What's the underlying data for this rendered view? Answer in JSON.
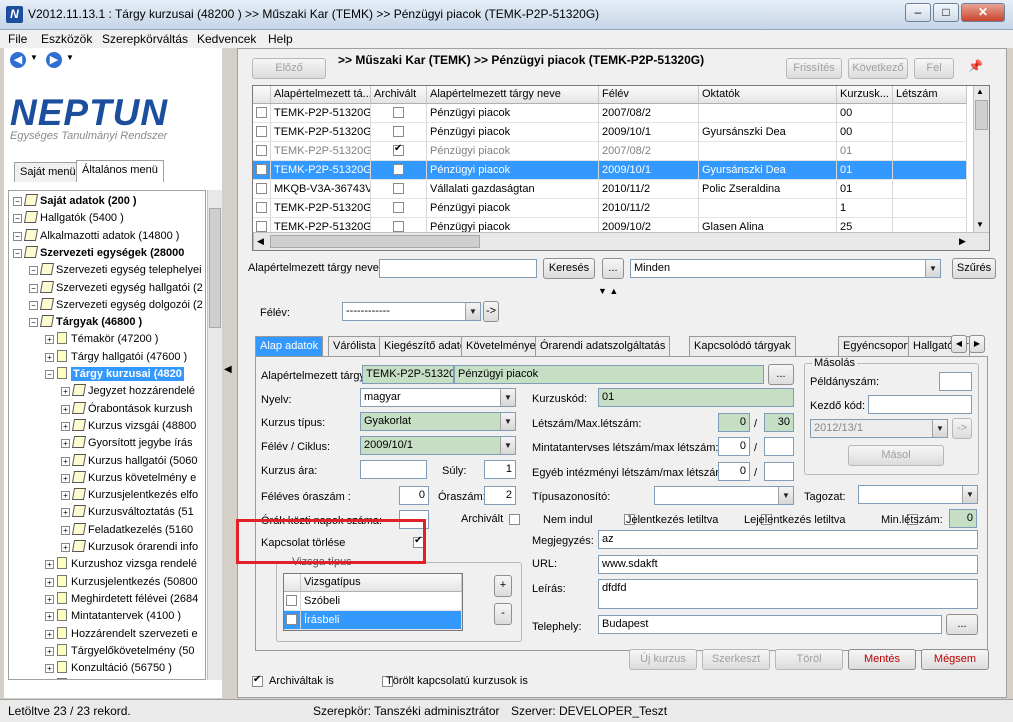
{
  "window": {
    "title": "V2012.11.13.1 : Tárgy kurzusai (48200  )  >> Műszaki Kar (TEMK) >> Pénzügyi piacok (TEMK-P2P-51320G)",
    "app_icon": "N",
    "minimize": "–",
    "maximize": "□",
    "close": "✕"
  },
  "menu": [
    "File",
    "Eszközök",
    "Szerepkörváltás",
    "Kedvencek",
    "Help"
  ],
  "logo": {
    "text": "NEPTUN",
    "subtitle": "Egységes Tanulmányi Rendszer"
  },
  "left_tabs": [
    "Saját menü",
    "Általános menü"
  ],
  "tree": [
    {
      "label": "Saját adatok (200 )",
      "bold": true,
      "level": 0,
      "icon": "diamond"
    },
    {
      "label": "Hallgatók (5400 )",
      "bold": false,
      "level": 0,
      "icon": "diamond"
    },
    {
      "label": "Alkalmazotti adatok (14800 )",
      "bold": false,
      "level": 0,
      "icon": "diamond"
    },
    {
      "label": "Szervezeti egységek (28000",
      "bold": true,
      "level": 0,
      "icon": "diamond"
    },
    {
      "label": "Szervezeti egység telephelyei",
      "bold": false,
      "level": 1,
      "icon": "diamond"
    },
    {
      "label": "Szervezeti egység hallgatói (2",
      "bold": false,
      "level": 1,
      "icon": "diamond"
    },
    {
      "label": "Szervezeti egység dolgozói (2",
      "bold": false,
      "level": 1,
      "icon": "diamond"
    },
    {
      "label": "Tárgyak (46800 )",
      "bold": true,
      "level": 1,
      "icon": "diamond"
    },
    {
      "label": "Témakör (47200 )",
      "bold": false,
      "level": 2,
      "icon": "doc"
    },
    {
      "label": "Tárgy hallgatói (47600 )",
      "bold": false,
      "level": 2,
      "icon": "doc"
    },
    {
      "label": "Tárgy kurzusai (4820",
      "bold": true,
      "level": 2,
      "icon": "doc",
      "selected": true
    },
    {
      "label": "Jegyzet hozzárendelé",
      "bold": false,
      "level": 3,
      "icon": "diamond"
    },
    {
      "label": "Órabontások kurzush",
      "bold": false,
      "level": 3,
      "icon": "diamond"
    },
    {
      "label": "Kurzus vizsgái (48800",
      "bold": false,
      "level": 3,
      "icon": "diamond"
    },
    {
      "label": "Gyorsított jegybe írás",
      "bold": false,
      "level": 3,
      "icon": "diamond"
    },
    {
      "label": "Kurzus hallgatói (5060",
      "bold": false,
      "level": 3,
      "icon": "diamond"
    },
    {
      "label": "Kurzus követelmény e",
      "bold": false,
      "level": 3,
      "icon": "diamond"
    },
    {
      "label": "Kurzusjelentkezés elfo",
      "bold": false,
      "level": 3,
      "icon": "diamond"
    },
    {
      "label": "Kurzusváltoztatás (51",
      "bold": false,
      "level": 3,
      "icon": "diamond"
    },
    {
      "label": "Feladatkezelés (5160",
      "bold": false,
      "level": 3,
      "icon": "diamond"
    },
    {
      "label": "Kurzusok órarendi info",
      "bold": false,
      "level": 3,
      "icon": "diamond"
    },
    {
      "label": "Kurzushoz vizsga rendelé",
      "bold": false,
      "level": 2,
      "icon": "doc"
    },
    {
      "label": "Kurzusjelentkezés (50800",
      "bold": false,
      "level": 2,
      "icon": "doc"
    },
    {
      "label": "Meghirdetett félévei (2684",
      "bold": false,
      "level": 2,
      "icon": "doc"
    },
    {
      "label": "Mintatantervek (4100 )",
      "bold": false,
      "level": 2,
      "icon": "doc"
    },
    {
      "label": "Hozzárendelt szervezeti e",
      "bold": false,
      "level": 2,
      "icon": "doc"
    },
    {
      "label": "Tárgyelőkövetelmény (50",
      "bold": false,
      "level": 2,
      "icon": "doc"
    },
    {
      "label": "Konzultáció (56750 )",
      "bold": false,
      "level": 2,
      "icon": "doc"
    },
    {
      "label": "Tárgy költsége (65350 )",
      "bold": false,
      "level": 2,
      "icon": "doc"
    },
    {
      "label": "Hozzárendelt tárgyak (2650 )",
      "bold": false,
      "level": 1,
      "icon": "diamond"
    },
    {
      "label": "Tárgycsoportok (54000 )",
      "bold": false,
      "level": 1,
      "icon": "diamond"
    }
  ],
  "toolbar": {
    "prev": "Előző",
    "breadcrumb": ">> Műszaki Kar (TEMK) >> Pénzügyi piacok (TEMK-P2P-51320G)",
    "refresh": "Frissítés",
    "next": "Következő",
    "up": "Fel",
    "pin": "📌"
  },
  "grid": {
    "columns": [
      "",
      "Alapértelmezett tá...",
      "Archivált",
      "Alapértelmezett tárgy neve",
      "Félév",
      "Oktatók",
      "Kurzusk...",
      "Létszám"
    ],
    "rows": [
      {
        "code": "TEMK-P2P-51320G",
        "archived": false,
        "name": "Pénzügyi piacok",
        "term": "2007/08/2",
        "teachers": "",
        "course": "00",
        "grey": false,
        "selected": false
      },
      {
        "code": "TEMK-P2P-51320G",
        "archived": false,
        "name": "Pénzügyi piacok",
        "term": "2009/10/1",
        "teachers": "Gyursánszki Dea",
        "course": "00",
        "grey": false,
        "selected": false
      },
      {
        "code": "TEMK-P2P-51320G",
        "archived": true,
        "name": "Pénzügyi piacok",
        "term": "2007/08/2",
        "teachers": "",
        "course": "01",
        "grey": true,
        "selected": false
      },
      {
        "code": "TEMK-P2P-51320G",
        "archived": false,
        "name": "Pénzügyi piacok",
        "term": "2009/10/1",
        "teachers": "Gyursánszki Dea",
        "course": "01",
        "grey": false,
        "selected": true
      },
      {
        "code": "MKQB-V3A-36743V",
        "archived": false,
        "name": "Vállalati gazdaságtan",
        "term": "2010/11/2",
        "teachers": "Polic Zseraldina",
        "course": "01",
        "grey": false,
        "selected": false
      },
      {
        "code": "TEMK-P2P-51320G",
        "archived": false,
        "name": "Pénzügyi piacok",
        "term": "2010/11/2",
        "teachers": "",
        "course": "1",
        "grey": false,
        "selected": false
      },
      {
        "code": "TEMK-P2P-51320G",
        "archived": false,
        "name": "Pénzügyi piacok",
        "term": "2009/10/2",
        "teachers": "Glasen Alina",
        "course": "25",
        "grey": false,
        "selected": false
      }
    ]
  },
  "search": {
    "label": "Alapértelmezett tárgy neve",
    "value": "",
    "button": "Keresés",
    "ellipsis": "...",
    "filter_value": "Minden",
    "filter_button": "Szűrés"
  },
  "semester": {
    "label": "Félév:",
    "value": "------------",
    "go": "->"
  },
  "detail_tabs": [
    "Alap adatok",
    "Várólista",
    "Kiegészítő adatok",
    "Követelmények",
    "Órarendi adatszolgáltatás",
    "Kapcsolódó tárgyak",
    "Egyéncsoportok",
    "Hallgatói ered"
  ],
  "form": {
    "default_subject_label": "Alapértelmezett tárgy:",
    "default_subject_code": "TEMK-P2P-51320G",
    "default_subject_name": "Pénzügyi piacok",
    "language_label": "Nyelv:",
    "language": "magyar",
    "course_type_label": "Kurzus típus:",
    "course_type": "Gyakorlat",
    "term_label": "Félév / Ciklus:",
    "term": "2009/10/1",
    "price_label": "Kurzus ára:",
    "price": "",
    "weight_label": "Súly:",
    "weight": "1",
    "hours_label": "Féléves óraszám :",
    "hours": "0",
    "weekly_hours_label": "Óraszám:",
    "weekly_hours": "2",
    "break_label": "Órák közti napok száma:",
    "break": "",
    "archived_label": "Archivált",
    "delete_rel_label": "Kapcsolat törlése",
    "course_code_label": "Kurzuskód:",
    "course_code": "01",
    "headcount_label": "Létszám/Max.létszám:",
    "headcount": "0",
    "max_headcount": "30",
    "curriculum_label": "Mintatantervses létszám/max létszám:",
    "curriculum_count": "0",
    "other_label": "Egyéb intézményi létszám/max létszám:",
    "other_count": "0",
    "type_id_label": "Típusazonosító:",
    "tagozat_label": "Tagozat:",
    "not_started_label": "Nem indul",
    "reg_block_label": "Jelentkezés letiltva",
    "dereg_block_label": "Lejelentkezés letiltva",
    "min_count_label": "Min.létszám:",
    "min_count": "0",
    "note_label": "Megjegyzés:",
    "note": "az",
    "url_label": "URL:",
    "url": "www.sdakft",
    "desc_label": "Leírás:",
    "desc": "dfdfd",
    "site_label": "Telephely:",
    "site": "Budapest",
    "exam_type_group": "Vizsga típus",
    "exam_type_header": "Vizsgatípus",
    "exam_types": [
      "Szóbeli",
      "Írásbeli"
    ],
    "plus": "+",
    "minus": "-"
  },
  "copy": {
    "title": "Másolás",
    "count_label": "Példányszám:",
    "start_label": "Kezdő kód:",
    "term": "2012/13/1",
    "arrow": "->",
    "button": "Másol"
  },
  "actions": {
    "new": "Új kurzus",
    "edit": "Szerkeszt",
    "delete": "Töröl",
    "save": "Mentés",
    "cancel": "Mégsem"
  },
  "bottom_checks": {
    "archived": "Archiváltak is",
    "deleted": "Törölt kapcsolatú kurzusok is"
  },
  "status": {
    "loaded": "Letöltve 23 / 23 rekord.",
    "role": "Szerepkör: Tanszéki adminisztrátor",
    "server": "Szerver: DEVELOPER_Teszt"
  }
}
